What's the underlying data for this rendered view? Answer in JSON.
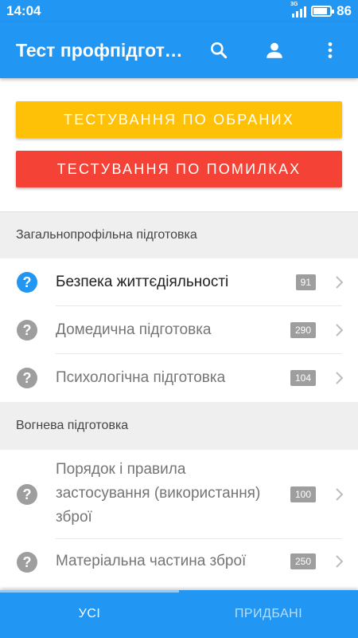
{
  "status_bar": {
    "time": "14:04",
    "network": "3G",
    "battery_pct": "86",
    "battery_level": 0.86
  },
  "app_bar": {
    "title": "Тест профпідготовки",
    "icons": [
      "search-icon",
      "account-icon",
      "more-vert-icon"
    ]
  },
  "buttons": {
    "favorites": "ТЕСТУВАННЯ ПО ОБРАНИХ",
    "mistakes": "ТЕСТУВАННЯ ПО ПОМИЛКАХ"
  },
  "sections": [
    {
      "title": "Загальнопрофільна підготовка",
      "items": [
        {
          "label": "Безпека життєдіяльності",
          "count": "91",
          "active": true
        },
        {
          "label": "Домедична підготовка",
          "count": "290",
          "active": false
        },
        {
          "label": "Психологічна підготовка",
          "count": "104",
          "active": false
        }
      ]
    },
    {
      "title": "Вогнева підготовка",
      "items": [
        {
          "label": "Порядок і правила застосування (використання) зброї",
          "label_lines": [
            "Порядок і правила",
            "застосування (використання)",
            "зброї"
          ],
          "count": "100",
          "active": false
        },
        {
          "label": "Матеріальна частина зброї",
          "count": "250",
          "active": false
        }
      ]
    }
  ],
  "tabs": {
    "all": "УСІ",
    "bought": "ПРИДБАНІ"
  },
  "colors": {
    "primary": "#2196f3",
    "yellow": "#ffc107",
    "red": "#f44336",
    "active_icon": "#2196f3",
    "inactive_icon": "#9e9e9e"
  }
}
